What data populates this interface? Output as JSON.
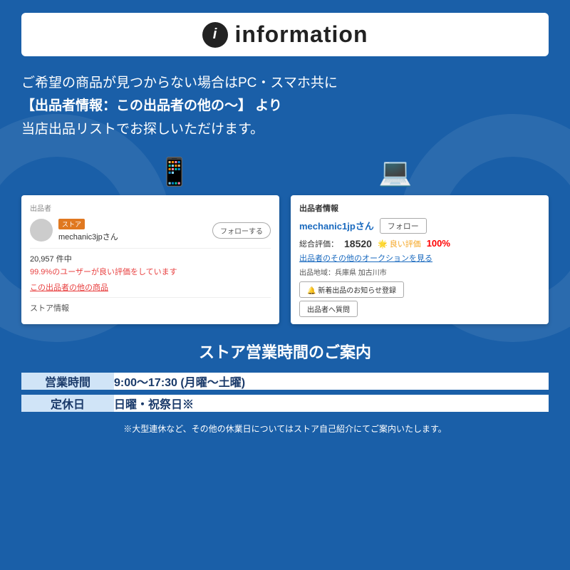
{
  "header": {
    "icon_label": "i",
    "title": "information"
  },
  "main_description": {
    "line1": "ご希望の商品が見つからない場合はPC・スマホ共に",
    "line2": "【出品者情報：この出品者の他の〜】 より",
    "line3": "当店出品リストでお探しいただけます。"
  },
  "mobile_screenshot": {
    "section_label": "出品者",
    "store_badge": "ストア",
    "username": "mechanic3jpさん",
    "follow_btn": "フォローする",
    "review_count": "20,957 件中",
    "review_pct": "99.9%のユーザーが良い評価をしています",
    "other_link": "この出品者の他の商品",
    "store_info": "ストア情報"
  },
  "pc_screenshot": {
    "section_label": "出品者情報",
    "username": "mechanic1jpさん",
    "follow_btn": "フォロー",
    "rating_label": "総合評価：",
    "rating_num": "18520",
    "good_label": "🌟 良い評価",
    "good_pct": "100%",
    "auction_link": "出品者のその他のオークションを見る",
    "location_label": "出品地域：兵庫県 加古川市",
    "notify_btn": "🔔 新着出品のお知らせ登録",
    "question_btn": "出品者へ質問"
  },
  "store_hours": {
    "title": "ストア営業時間のご案内",
    "rows": [
      {
        "label": "営業時間",
        "value": "9:00〜17:30 (月曜〜土曜)"
      },
      {
        "label": "定休日",
        "value": "日曜・祝祭日※"
      }
    ]
  },
  "footer_note": "※大型連休など、その他の休業日についてはストア自己紹介にてご案内いたします。",
  "icons": {
    "mobile": "📱",
    "pc": "💻"
  }
}
